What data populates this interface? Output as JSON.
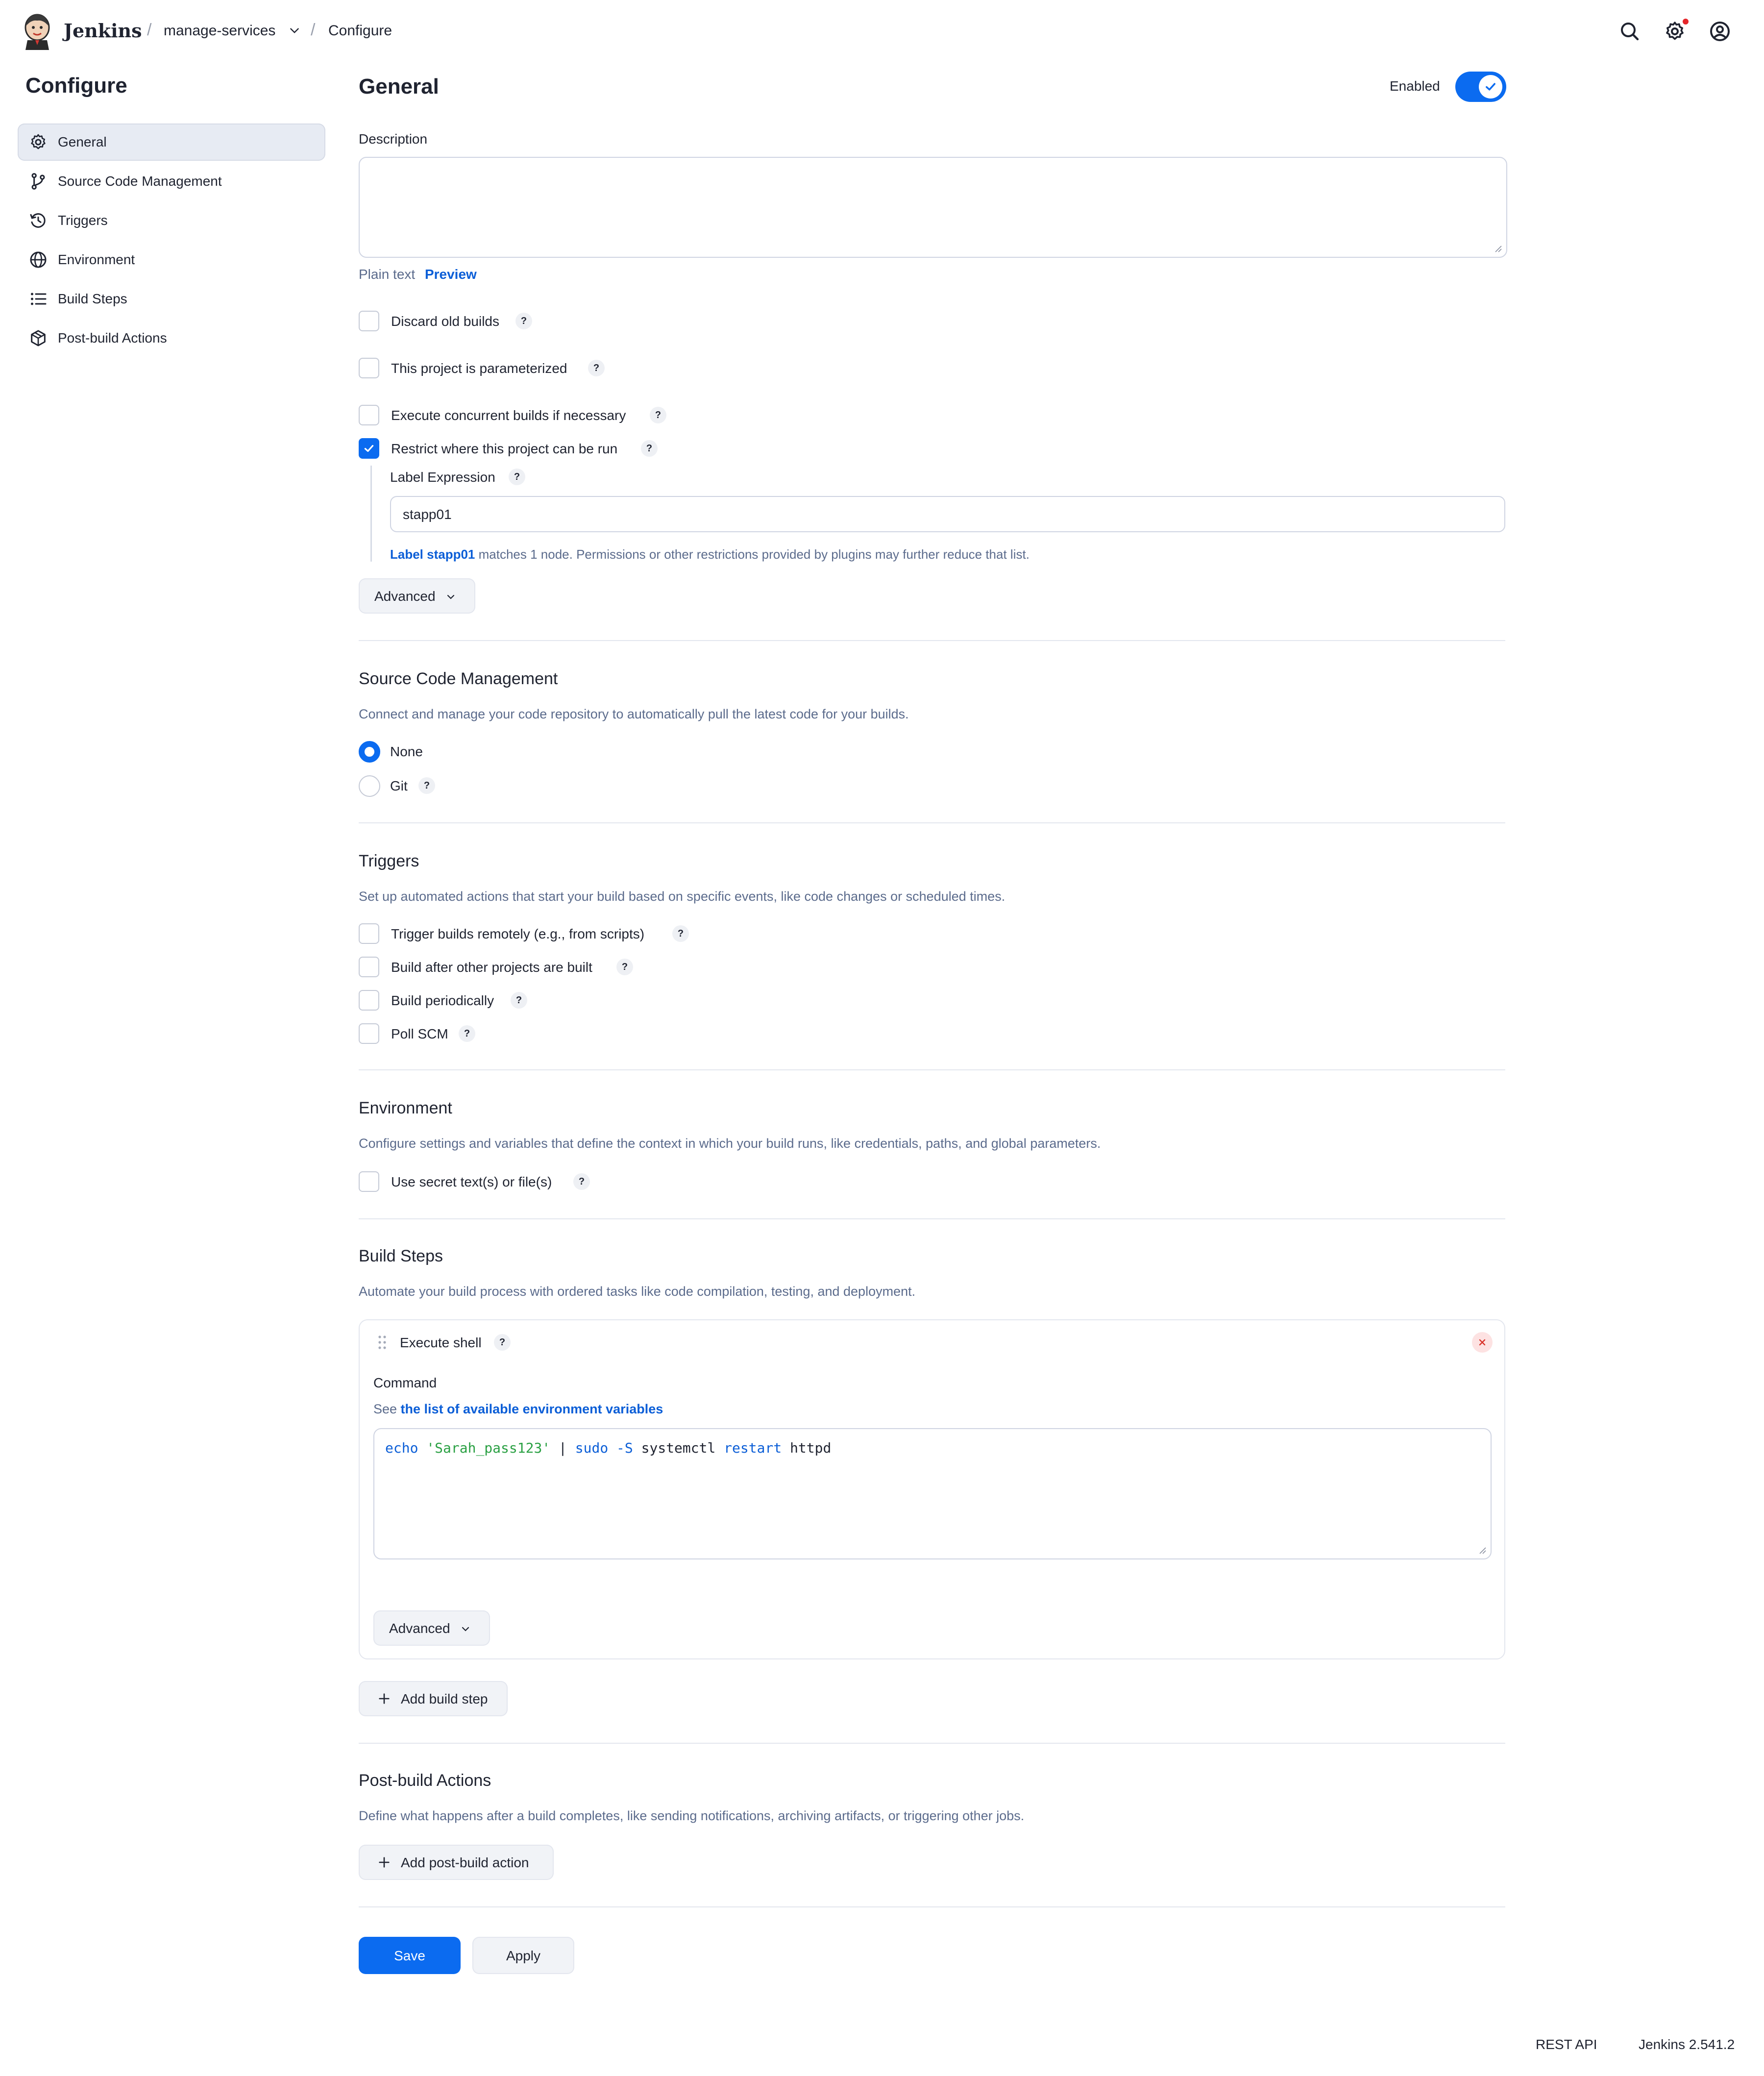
{
  "header": {
    "brand": "Jenkins",
    "breadcrumb": {
      "job": "manage-services",
      "page": "Configure"
    },
    "icons": [
      "search-icon",
      "settings-icon",
      "user-icon"
    ],
    "colors": {
      "notification": "#e5262a"
    }
  },
  "sidebar": {
    "title": "Configure",
    "items": [
      {
        "label": "General",
        "icon": "gear-icon",
        "active": true
      },
      {
        "label": "Source Code Management",
        "icon": "git-branch-icon",
        "active": false
      },
      {
        "label": "Triggers",
        "icon": "clock-icon",
        "active": false
      },
      {
        "label": "Environment",
        "icon": "globe-icon",
        "active": false
      },
      {
        "label": "Build Steps",
        "icon": "list-icon",
        "active": false
      },
      {
        "label": "Post-build Actions",
        "icon": "package-icon",
        "active": false
      }
    ]
  },
  "general": {
    "title": "General",
    "enabled_label": "Enabled",
    "enabled": true,
    "description_label": "Description",
    "description_value": "",
    "format": {
      "plain": "Plain text",
      "preview": "Preview"
    },
    "options": [
      {
        "label": "Discard old builds",
        "checked": false
      },
      {
        "label": "This project is parameterized",
        "checked": false
      },
      {
        "label": "Execute concurrent builds if necessary",
        "checked": false
      },
      {
        "label": "Restrict where this project can be run",
        "checked": true
      }
    ],
    "label_expression": {
      "label": "Label Expression",
      "value": "stapp01",
      "hint_link": "Label stapp01",
      "hint_text": " matches 1 node. Permissions or other restrictions provided by plugins may further reduce that list."
    },
    "advanced_label": "Advanced"
  },
  "scm": {
    "title": "Source Code Management",
    "description": "Connect and manage your code repository to automatically pull the latest code for your builds.",
    "options": [
      {
        "label": "None",
        "selected": true
      },
      {
        "label": "Git",
        "selected": false
      }
    ]
  },
  "triggers": {
    "title": "Triggers",
    "description": "Set up automated actions that start your build based on specific events, like code changes or scheduled times.",
    "options": [
      {
        "label": "Trigger builds remotely (e.g., from scripts)",
        "checked": false
      },
      {
        "label": "Build after other projects are built",
        "checked": false
      },
      {
        "label": "Build periodically",
        "checked": false
      },
      {
        "label": "Poll SCM",
        "checked": false
      }
    ]
  },
  "environment": {
    "title": "Environment",
    "description": "Configure settings and variables that define the context in which your build runs, like credentials, paths, and global parameters.",
    "options": [
      {
        "label": "Use secret text(s) or file(s)",
        "checked": false
      }
    ]
  },
  "build_steps": {
    "title": "Build Steps",
    "description": "Automate your build process with ordered tasks like code compilation, testing, and deployment.",
    "step": {
      "title": "Execute shell",
      "command_label": "Command",
      "see_prefix": "See ",
      "see_link": "the list of available environment variables",
      "code": {
        "t1": "echo",
        "t2": "'Sarah_pass123'",
        "t3": "|",
        "t4": "sudo -S",
        "t5": "systemctl",
        "t6": "restart",
        "t7": "httpd"
      },
      "advanced_label": "Advanced"
    },
    "add_label": "Add build step"
  },
  "post_build": {
    "title": "Post-build Actions",
    "description": "Define what happens after a build completes, like sending notifications, archiving artifacts, or triggering other jobs.",
    "add_label": "Add post-build action"
  },
  "actions": {
    "save": "Save",
    "apply": "Apply"
  },
  "footer": {
    "rest_api": "REST API",
    "version": "Jenkins 2.541.2"
  },
  "colors": {
    "accent": "#0b6bf0",
    "link": "#0b5ed7",
    "muted": "#5b6b8c",
    "code_string": "#2aa043"
  }
}
